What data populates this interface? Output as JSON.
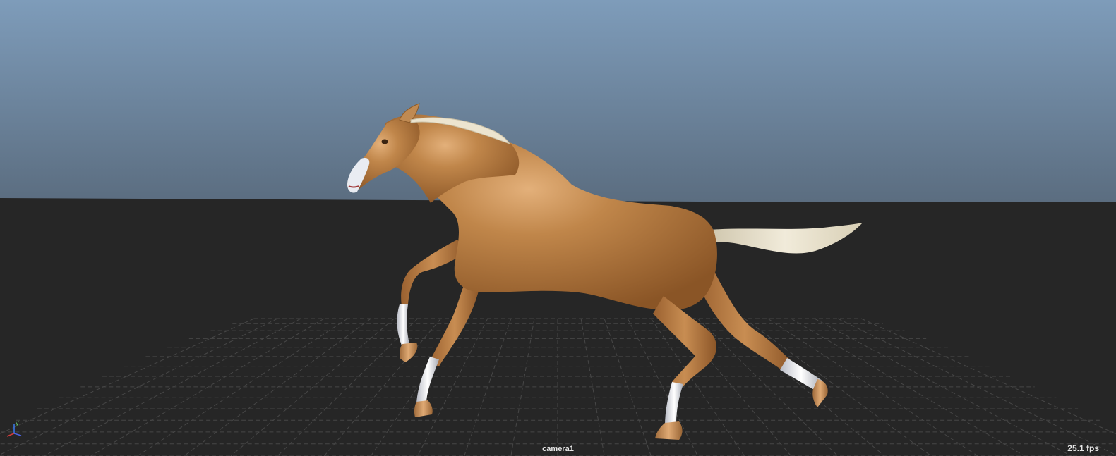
{
  "viewport": {
    "camera_name": "camera1",
    "fps_readout": "25.1 fps",
    "colors": {
      "sky_top": "#7d9bb9",
      "sky_bottom": "#5e7184",
      "ground": "#262626",
      "grid": "#4a4a4a",
      "horse_coat": "#b77b3e",
      "mane_tail": "#e7dfc8",
      "socks": "#e6e6ea",
      "hooves": "#c8905a"
    },
    "axis_gizmo": {
      "up_axis_label": "y",
      "icon": "axis-gizmo-icon"
    },
    "subject": "horse-model"
  }
}
